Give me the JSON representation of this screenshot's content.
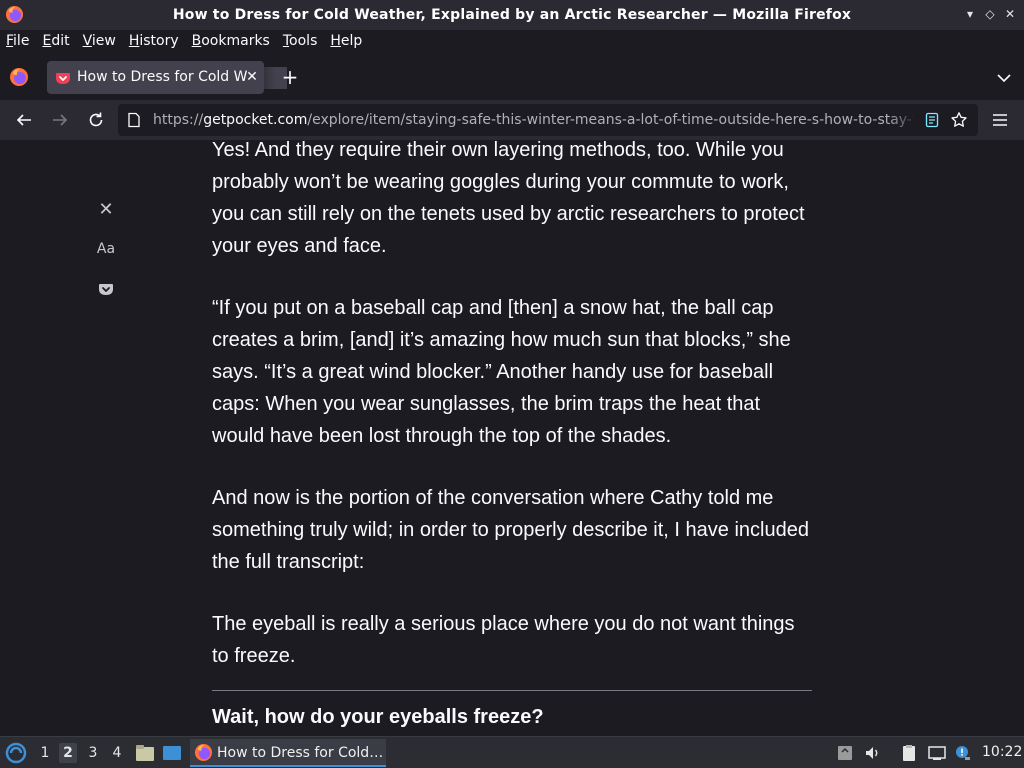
{
  "window": {
    "title": "How to Dress for Cold Weather, Explained by an Arctic Researcher — Mozilla Firefox",
    "controls": {
      "minimize": "▾",
      "restore": "◇",
      "close": "✕"
    }
  },
  "menubar": [
    {
      "label": "File",
      "accel": "F",
      "rest": "ile"
    },
    {
      "label": "Edit",
      "accel": "E",
      "rest": "dit"
    },
    {
      "label": "View",
      "accel": "V",
      "rest": "iew"
    },
    {
      "label": "History",
      "accel": "H",
      "rest": "istory"
    },
    {
      "label": "Bookmarks",
      "accel": "B",
      "rest": "ookmarks"
    },
    {
      "label": "Tools",
      "accel": "T",
      "rest": "ools"
    },
    {
      "label": "Help",
      "accel": "H",
      "rest": "elp"
    }
  ],
  "tab": {
    "label": "How to Dress for Cold Weather, Explained by an Arctic Researcher",
    "close": "✕",
    "new_tab": "+"
  },
  "navbar": {
    "url_prefix": "https://",
    "url_domain": "getpocket.com",
    "url_path": "/explore/item/staying-safe-this-winter-means-a-lot-of-time-outside-here-s-how-to-stay-warm"
  },
  "reader": {
    "toolbar": {
      "close": "✕",
      "type_controls": "Aa"
    },
    "paragraphs": [
      "Yes! And they require their own layering methods, too. While you probably won’t be wearing goggles during your commute to work, you can still rely on the tenets used by arctic researchers to protect your eyes and face.",
      "“If you put on a baseball cap and [then] a snow hat, the ball cap creates a brim, [and] it’s amazing how much sun that blocks,” she says. “It’s a great wind blocker.” Another handy use for baseball caps: When you wear sunglasses, the brim traps the heat that would have been lost through the top of the shades.",
      "And now is the portion of the conversation where Cathy told me something truly wild; in order to properly describe it, I have included the full transcript:",
      "The eyeball is really a serious place where you do not want things to freeze."
    ],
    "heading": "Wait, how do your eyeballs freeze?"
  },
  "taskbar": {
    "workspaces": [
      "1",
      "2",
      "3",
      "4"
    ],
    "active_workspace": "2",
    "task_label": "How to Dress for Cold…",
    "clock": "10:22"
  },
  "colors": {
    "accent": "#3d8fd6",
    "background": "#1c1b22",
    "toolbar": "#2b2a33",
    "tab_selected": "#42414d",
    "pocket": "#ef4056"
  }
}
